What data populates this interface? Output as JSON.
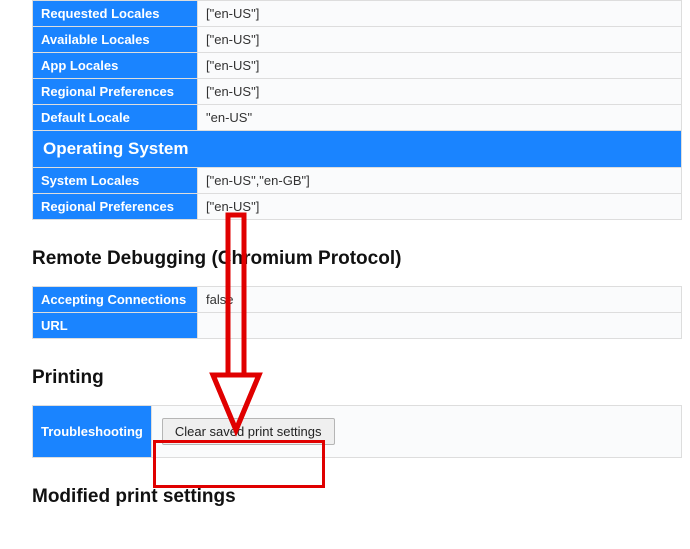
{
  "locale_rows": {
    "requested_locales": {
      "label": "Requested Locales",
      "value": "[\"en-US\"]"
    },
    "available_locales": {
      "label": "Available Locales",
      "value": "[\"en-US\"]"
    },
    "app_locales": {
      "label": "App Locales",
      "value": "[\"en-US\"]"
    },
    "regional_preferences": {
      "label": "Regional Preferences",
      "value": "[\"en-US\"]"
    },
    "default_locale": {
      "label": "Default Locale",
      "value": "\"en-US\""
    }
  },
  "os_section": {
    "title": "Operating System",
    "system_locales": {
      "label": "System Locales",
      "value": "[\"en-US\",\"en-GB\"]"
    },
    "regional_preferences": {
      "label": "Regional Preferences",
      "value": "[\"en-US\"]"
    }
  },
  "remote_debugging": {
    "title": "Remote Debugging (Chromium Protocol)",
    "accepting_connections": {
      "label": "Accepting Connections",
      "value": "false"
    },
    "url": {
      "label": "URL",
      "value": ""
    }
  },
  "printing": {
    "title": "Printing",
    "troubleshooting_label": "Troubleshooting",
    "clear_button": "Clear saved print settings"
  },
  "modified_print_settings": {
    "title": "Modified print settings"
  }
}
